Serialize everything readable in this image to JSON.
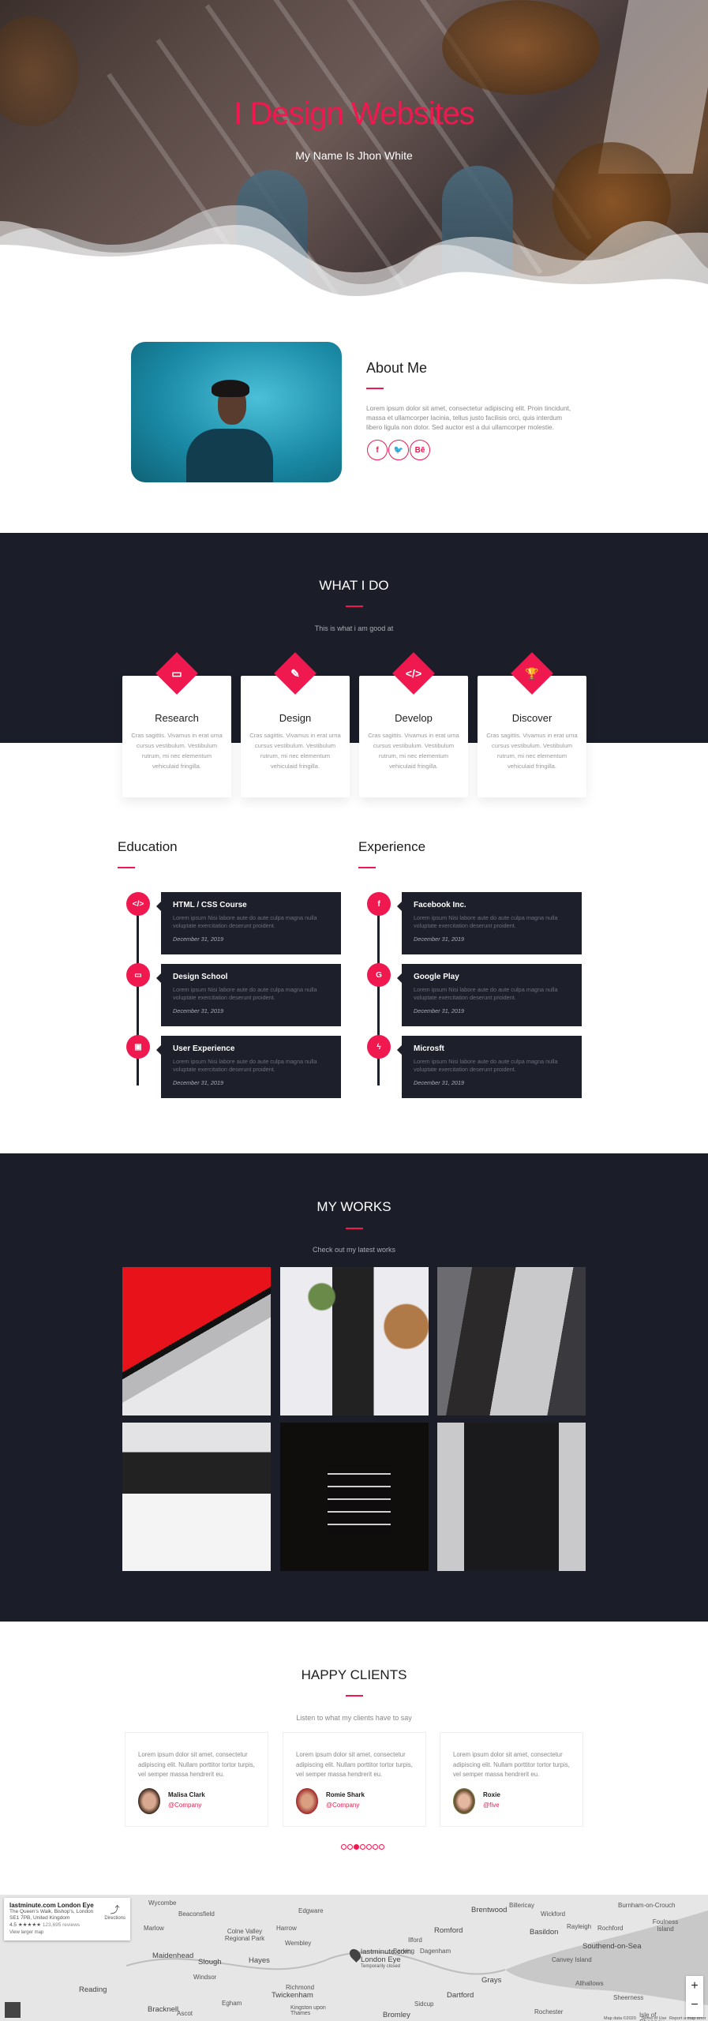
{
  "hero": {
    "title": "I Design Websites",
    "subtitle": "My Name Is Jhon White"
  },
  "about": {
    "title": "About Me",
    "text": "Lorem ipsum dolor sit amet, consectetur adipiscing elit. Proin tincidunt, massa et ullamcorper lacinia, tellus justo facilisis orci, quis interdum libero ligula non dolor. Sed auctor est a dui ullamcorper molestie.",
    "social": [
      {
        "icon": "facebook-icon",
        "label": "f"
      },
      {
        "icon": "twitter-icon",
        "label": "🐦"
      },
      {
        "icon": "behance-icon",
        "label": "Bē"
      }
    ]
  },
  "services": {
    "title": "WHAT I DO",
    "subtitle": "This is what i am good at",
    "items": [
      {
        "icon": "monitor-icon",
        "glyph": "▭",
        "title": "Research",
        "text": "Cras sagittis. Vivamus in erat urna cursus vestibulum. Vestibulum rutrum, mi nec elementum vehiculaid fringilla."
      },
      {
        "icon": "paintbrush-icon",
        "glyph": "✎",
        "title": "Design",
        "text": "Cras sagittis. Vivamus in erat urna cursus vestibulum. Vestibulum rutrum, mi nec elementum vehiculaid fringilla."
      },
      {
        "icon": "code-icon",
        "glyph": "</>",
        "title": "Develop",
        "text": "Cras sagittis. Vivamus in erat urna cursus vestibulum. Vestibulum rutrum, mi nec elementum vehiculaid fringilla."
      },
      {
        "icon": "trophy-icon",
        "glyph": "🏆",
        "title": "Discover",
        "text": "Cras sagittis. Vivamus in erat urna cursus vestibulum. Vestibulum rutrum, mi nec elementum vehiculaid fringilla."
      }
    ]
  },
  "education": {
    "title": "Education",
    "items": [
      {
        "icon": "code-icon",
        "glyph": "</>",
        "title": "HTML / CSS Course",
        "text": "Lorem ipsum Nisi labore aute do aute culpa magna nulla voluptate exercitation deserunt proident.",
        "date": "December 31, 2019"
      },
      {
        "icon": "monitor-icon",
        "glyph": "▭",
        "title": "Design School",
        "text": "Lorem ipsum Nisi labore aute do aute culpa magna nulla voluptate exercitation deserunt proident.",
        "date": "December 31, 2019"
      },
      {
        "icon": "calendar-icon",
        "glyph": "▣",
        "title": "User Experience",
        "text": "Lorem ipsum Nisi labore aute do aute culpa magna nulla voluptate exercitation deserunt proident.",
        "date": "December 31, 2019"
      }
    ]
  },
  "experience": {
    "title": "Experience",
    "items": [
      {
        "icon": "facebook-icon",
        "glyph": "f",
        "title": "Facebook Inc.",
        "text": "Lorem ipsum Nisi labore aute do aute culpa magna nulla voluptate exercitation deserunt proident.",
        "date": "December 31, 2019"
      },
      {
        "icon": "google-icon",
        "glyph": "G",
        "title": "Google Play",
        "text": "Lorem ipsum Nisi labore aute do aute culpa magna nulla voluptate exercitation deserunt proident.",
        "date": "December 31, 2019"
      },
      {
        "icon": "bolt-icon",
        "glyph": "ϟ",
        "title": "Microsft",
        "text": "Lorem ipsum Nisi labore aute do aute culpa magna nulla voluptate exercitation deserunt proident.",
        "date": "December 31, 2019"
      }
    ]
  },
  "works": {
    "title": "MY WORKS",
    "subtitle": "Check out my latest works"
  },
  "clients": {
    "title": "HAPPY CLIENTS",
    "subtitle": "Listen to what my clients have to say",
    "items": [
      {
        "text": "Lorem ipsum dolor sit amet, consectetur adipiscing elit. Nullam porttitor tortor turpis, vel semper massa hendrerit eu.",
        "name": "Malisa Clark",
        "company": "@Company"
      },
      {
        "text": "Lorem ipsum dolor sit amet, consectetur adipiscing elit. Nullam porttitor tortor turpis, vel semper massa hendrerit eu.",
        "name": "Romie Shark",
        "company": "@Company"
      },
      {
        "text": "Lorem ipsum dolor sit amet, consectetur adipiscing elit. Nullam porttitor tortor turpis, vel semper massa hendrerit eu.",
        "name": "Roxie",
        "company": "@five"
      }
    ],
    "active_dot": 3,
    "dot_count": 7
  },
  "map": {
    "place": "lastminute.com London Eye",
    "address": "The Queen's Walk, Bishop's, London SE1 7PB, United Kingdom",
    "rating": "4.5",
    "stars": "★★★★★",
    "reviews": "123,695 reviews",
    "directions": "Directions",
    "larger": "View larger map",
    "pin_label": "lastminute.com London Eye",
    "pin_status": "Temporarily closed",
    "attribution": "Map data ©2020",
    "terms": "Terms of Use",
    "report": "Report a map error",
    "places": [
      "Wycombe",
      "Beaconsfield",
      "Marlow",
      "Maidenhead",
      "Slough",
      "Windsor",
      "Reading",
      "Bracknell",
      "Ascot",
      "Egham",
      "Hayes",
      "Harrow",
      "Wembley",
      "Edgware",
      "Twickenham",
      "Richmond",
      "Kingston upon Thames",
      "Romford",
      "Ilford",
      "Barking",
      "Dagenham",
      "Brentwood",
      "Billericay",
      "Wickford",
      "Basildon",
      "Rayleigh",
      "Rochford",
      "Southend-on-Sea",
      "Canvey Island",
      "Grays",
      "Dartford",
      "Bromley",
      "Sidcup",
      "Allhallows",
      "Rochester",
      "Sheerness",
      "Isle of Sheppey",
      "Foulness Island",
      "Burnham-on-Crouch",
      "Colne Valley Regional Park"
    ]
  },
  "colors": {
    "accent": "#f0194f",
    "dark": "#1b1e29"
  }
}
